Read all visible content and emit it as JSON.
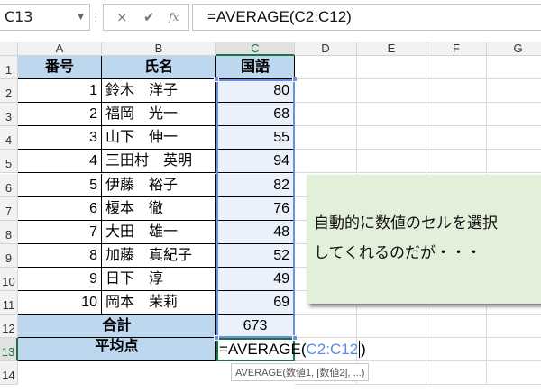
{
  "formula_bar": {
    "name_box": "C13",
    "cancel_icon": "×",
    "enter_icon": "✔",
    "fx_icon": "fx",
    "formula": "=AVERAGE(C2:C12)"
  },
  "columns": [
    "A",
    "B",
    "C",
    "D",
    "E",
    "F",
    "G"
  ],
  "rows": [
    "1",
    "2",
    "3",
    "4",
    "5",
    "6",
    "7",
    "8",
    "9",
    "10",
    "11",
    "12",
    "13",
    "14"
  ],
  "header": {
    "no": "番号",
    "name": "氏名",
    "score": "国語"
  },
  "records": [
    {
      "no": "1",
      "name": "鈴木　洋子",
      "score": "80"
    },
    {
      "no": "2",
      "name": "福岡　光一",
      "score": "68"
    },
    {
      "no": "3",
      "name": "山下　伸一",
      "score": "55"
    },
    {
      "no": "4",
      "name": "三田村　英明",
      "score": "94"
    },
    {
      "no": "5",
      "name": "伊藤　裕子",
      "score": "82"
    },
    {
      "no": "6",
      "name": "榎本　徹",
      "score": "76"
    },
    {
      "no": "7",
      "name": "大田　雄一",
      "score": "48"
    },
    {
      "no": "8",
      "name": "加藤　真紀子",
      "score": "52"
    },
    {
      "no": "9",
      "name": "日下　淳",
      "score": "49"
    },
    {
      "no": "10",
      "name": "岡本　茉莉",
      "score": "69"
    }
  ],
  "total": {
    "label": "合計",
    "value": "673"
  },
  "average": {
    "label": "平均点",
    "formula_prefix": "=AVERAGE(",
    "formula_range": "C2:C12",
    "formula_suffix": ")"
  },
  "tooltip": "AVERAGE(数値1, [数値2], ...)",
  "callout": {
    "line1": "自動的に数値のセルを選択",
    "line2": "してくれるのだが・・・"
  },
  "colors": {
    "header_fill": "#bdd7ee",
    "range_fill": "#eaf1fb",
    "range_border": "#6d8fe0",
    "active_border": "#217346",
    "callout_fill": "#e2efd9"
  }
}
